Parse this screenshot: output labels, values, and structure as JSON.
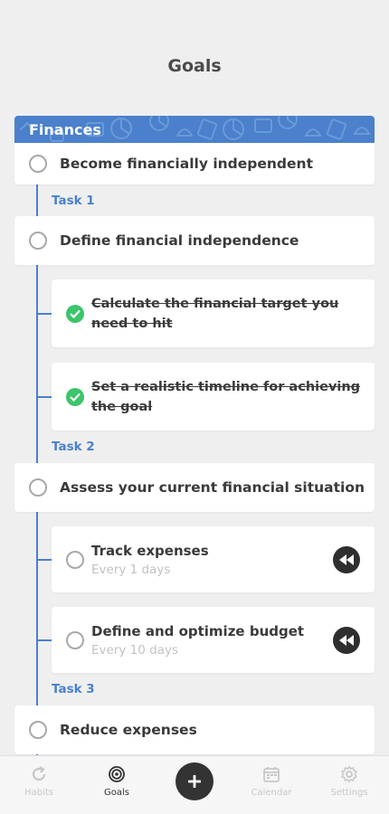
{
  "header": {
    "title": "Goals"
  },
  "goal": {
    "category": "Finances",
    "title": "Become financially independent",
    "accent": "#4a80cc"
  },
  "tasks": [
    {
      "label": "Task 1",
      "title": "Define financial independence",
      "subtasks": [
        {
          "title": "Calculate the financial target you need to hit",
          "done": true
        },
        {
          "title": "Set a realistic timeline for achieving the goal",
          "done": true
        }
      ]
    },
    {
      "label": "Task 2",
      "title": "Assess your current financial situation",
      "habits": [
        {
          "title": "Track expenses",
          "frequency": "Every 1 days",
          "icon": "rewind-icon"
        },
        {
          "title": "Define and optimize budget",
          "frequency": "Every 10 days",
          "icon": "rewind-icon"
        }
      ]
    },
    {
      "label": "Task 3",
      "title": "Reduce expenses"
    }
  ],
  "tabbar": {
    "items": [
      {
        "label": "Habits",
        "icon": "refresh-icon",
        "active": false
      },
      {
        "label": "Goals",
        "icon": "target-icon",
        "active": true
      },
      {
        "label": "",
        "icon": "plus-icon",
        "active": false
      },
      {
        "label": "Calendar",
        "icon": "calendar-icon",
        "active": false
      },
      {
        "label": "Settings",
        "icon": "gear-icon",
        "active": false
      }
    ]
  },
  "colors": {
    "done": "#3cc56a",
    "background": "#efefef"
  }
}
